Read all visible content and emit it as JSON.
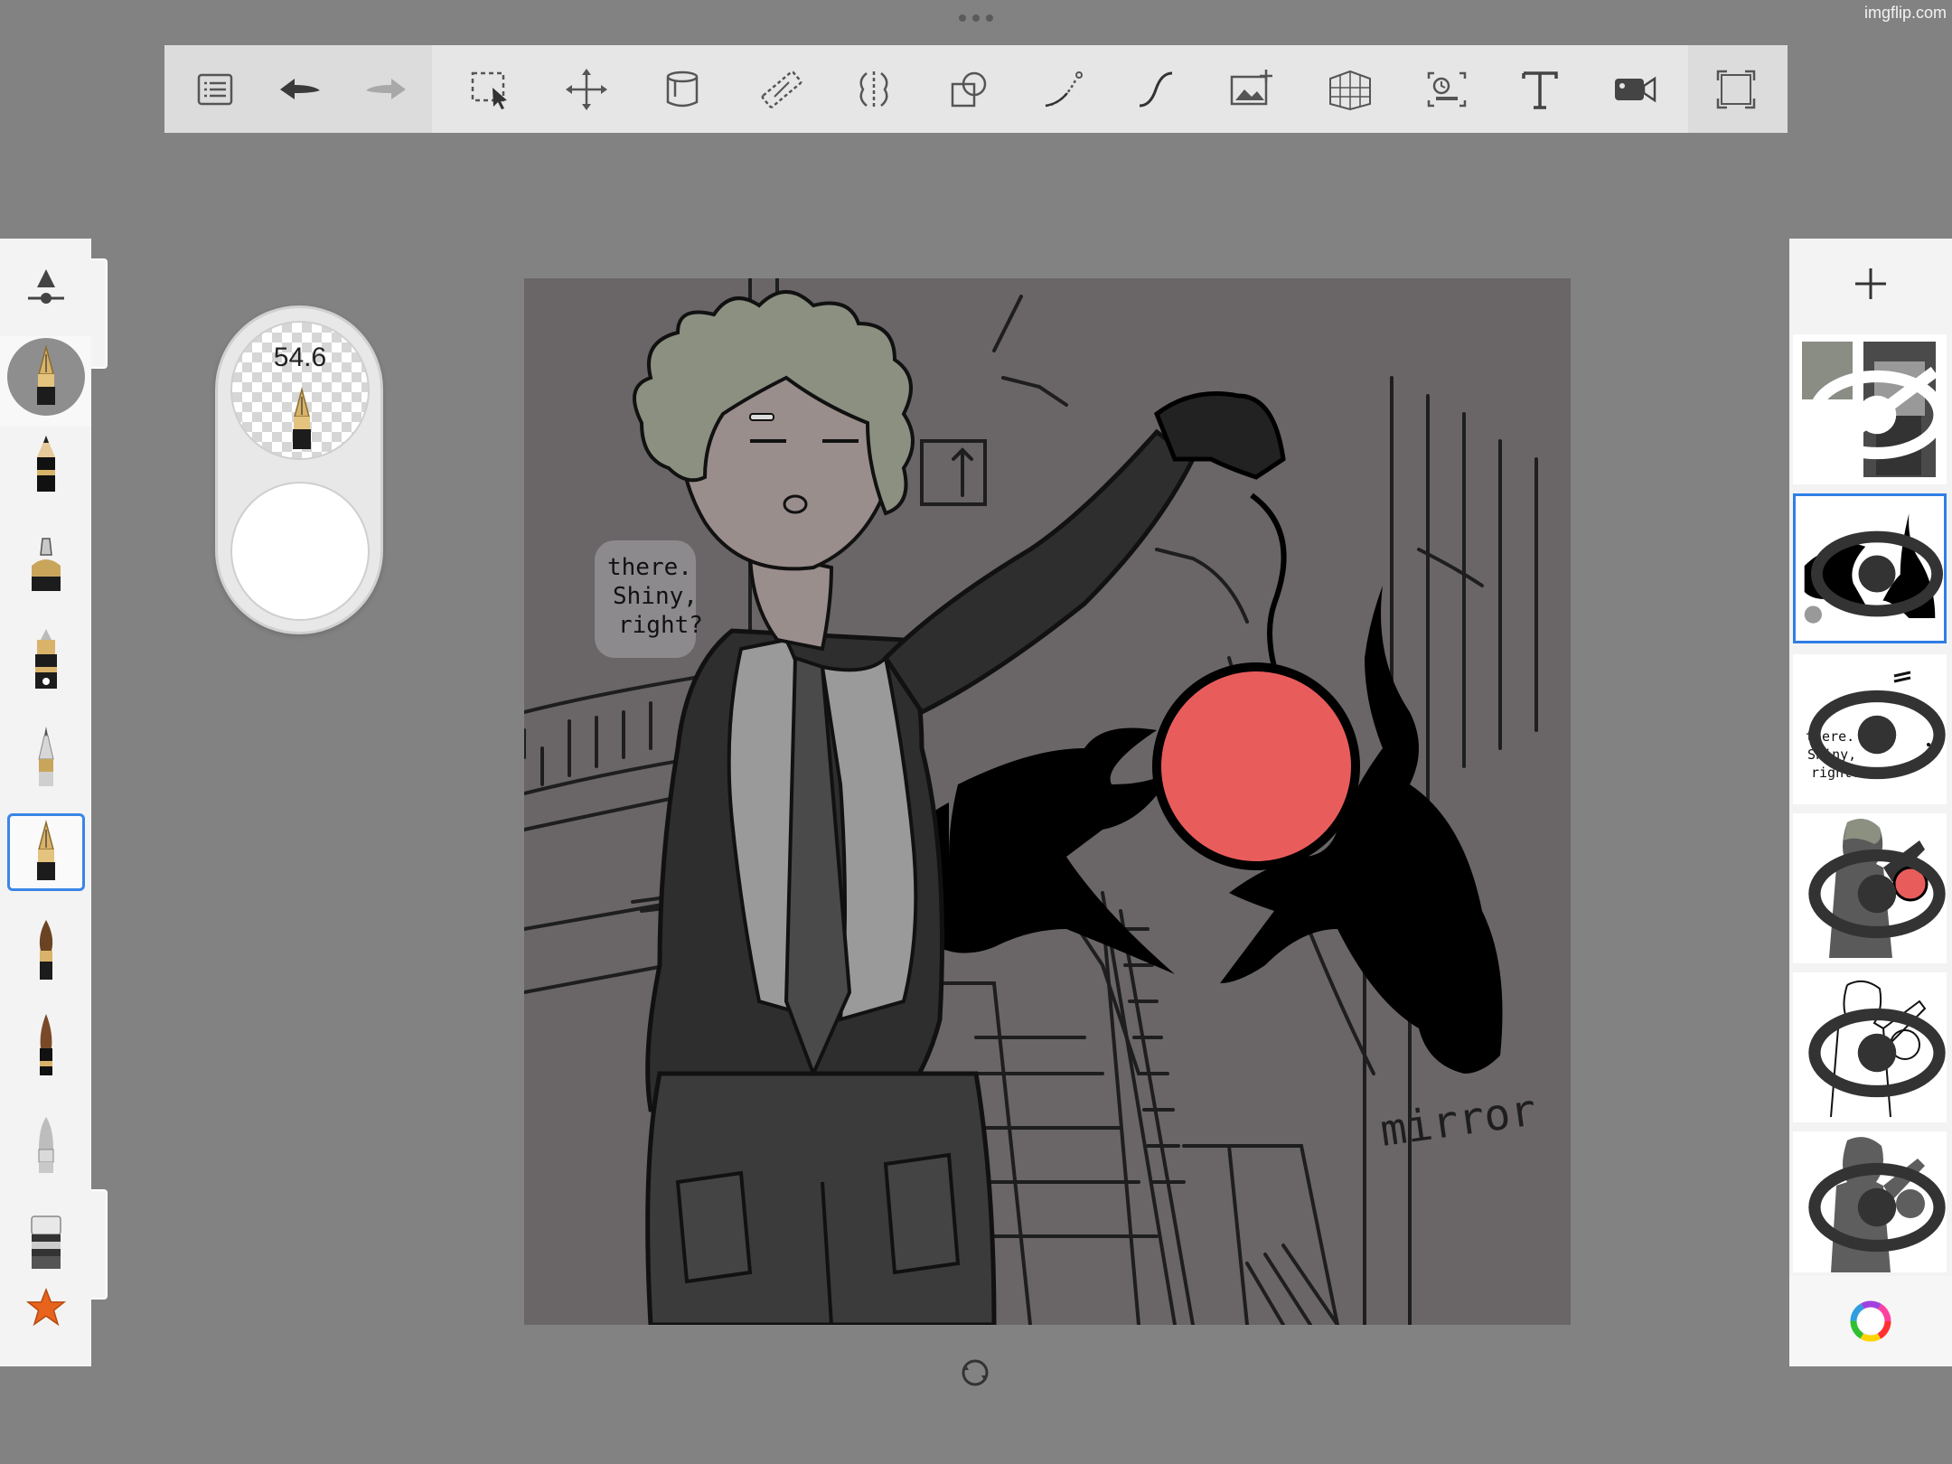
{
  "watermark": "imgflip.com",
  "toolbar": {
    "tools": [
      {
        "name": "layers-list-icon"
      },
      {
        "name": "undo-icon"
      },
      {
        "name": "redo-icon"
      },
      {
        "name": "selection-icon"
      },
      {
        "name": "transform-icon"
      },
      {
        "name": "fill-bucket-icon"
      },
      {
        "name": "ruler-icon"
      },
      {
        "name": "symmetry-icon"
      },
      {
        "name": "shapes-icon"
      },
      {
        "name": "curve-icon"
      },
      {
        "name": "stroke-icon"
      },
      {
        "name": "add-image-icon"
      },
      {
        "name": "perspective-grid-icon"
      },
      {
        "name": "timelapse-icon"
      },
      {
        "name": "text-icon"
      },
      {
        "name": "video-record-icon"
      },
      {
        "name": "fullscreen-icon"
      }
    ]
  },
  "brushes": {
    "items": [
      "brush-settings",
      "fountain-pen",
      "pencil",
      "airbrush",
      "ink-pen",
      "technical-pen",
      "fountain-pen-selected",
      "paintbrush",
      "brush",
      "marker",
      "eraser",
      "favorites-star"
    ]
  },
  "puck": {
    "size_value": "54.6",
    "opacity_color": "#ffffff"
  },
  "canvas": {
    "speech_lines": [
      "there.",
      "Shiny,",
      "right?"
    ],
    "signature": "mirror",
    "colors": {
      "background": "#6a6668",
      "orb": "#e85d5c",
      "hair": "#8b9081",
      "skin": "#9a8e8c",
      "vest": "#9a9a9a",
      "jacket": "#2e2e2e",
      "pants": "#3b3b3b",
      "crows": "#000000"
    }
  },
  "layers": {
    "add_icon": "plus-icon",
    "items": [
      {
        "name": "layer-reference",
        "visible": false,
        "selected": false
      },
      {
        "name": "layer-crows",
        "visible": true,
        "selected": true
      },
      {
        "name": "layer-text",
        "visible": true,
        "selected": false
      },
      {
        "name": "layer-color",
        "visible": true,
        "selected": false
      },
      {
        "name": "layer-lineart",
        "visible": true,
        "selected": false
      },
      {
        "name": "layer-silhouette",
        "visible": true,
        "selected": false
      }
    ],
    "text_thumb_lines": [
      "there.",
      "Shiny,",
      "right?"
    ]
  },
  "color_picker": "color-wheel-icon"
}
